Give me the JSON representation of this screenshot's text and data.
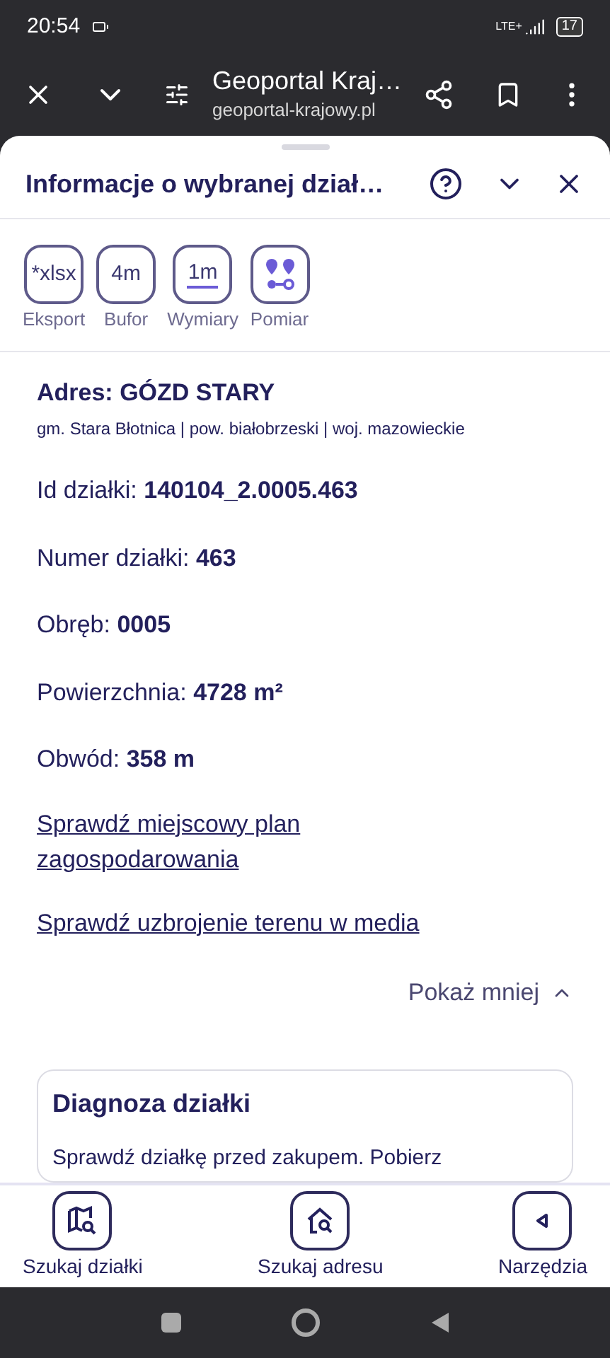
{
  "status_bar": {
    "time": "20:54",
    "network": "LTE+",
    "battery": "17"
  },
  "browser": {
    "title": "Geoportal Kraj…",
    "url": "geoportal-krajowy.pl"
  },
  "panel": {
    "title": "Informacje o wybranej dział…"
  },
  "tools": [
    {
      "label": "Eksport",
      "icon_text": "*xlsx",
      "kind": "text"
    },
    {
      "label": "Bufor",
      "icon_text": "4m",
      "kind": "text"
    },
    {
      "label": "Wymiary",
      "icon_text": "1m",
      "kind": "ruler"
    },
    {
      "label": "Pomiar",
      "kind": "pins"
    }
  ],
  "address": {
    "title": "Adres: GÓZD STARY",
    "subtitle": "gm. Stara Błotnica | pow. białobrzeski | woj. mazowieckie"
  },
  "details": [
    {
      "label": "Id działki:",
      "value": "140104_2.0005.463"
    },
    {
      "label": "Numer działki:",
      "value": "463"
    },
    {
      "label": "Obręb:",
      "value": "0005"
    },
    {
      "label": "Powierzchnia:",
      "value": "4728 m²"
    },
    {
      "label": "Obwód:",
      "value": "358 m"
    }
  ],
  "links": [
    "Sprawdź miejscowy plan zagospodarowania",
    "Sprawdź uzbrojenie terenu w media"
  ],
  "toggle": {
    "label": "Pokaż mniej",
    "expanded": true
  },
  "diagnosis": {
    "title": "Diagnoza działki",
    "text": "Sprawdź działkę przed zakupem. Pobierz"
  },
  "bottom_nav": [
    {
      "label": "Szukaj działki",
      "kind": "map"
    },
    {
      "label": "Szukaj adresu",
      "kind": "house"
    },
    {
      "label": "Narzędzia",
      "kind": "back"
    }
  ]
}
